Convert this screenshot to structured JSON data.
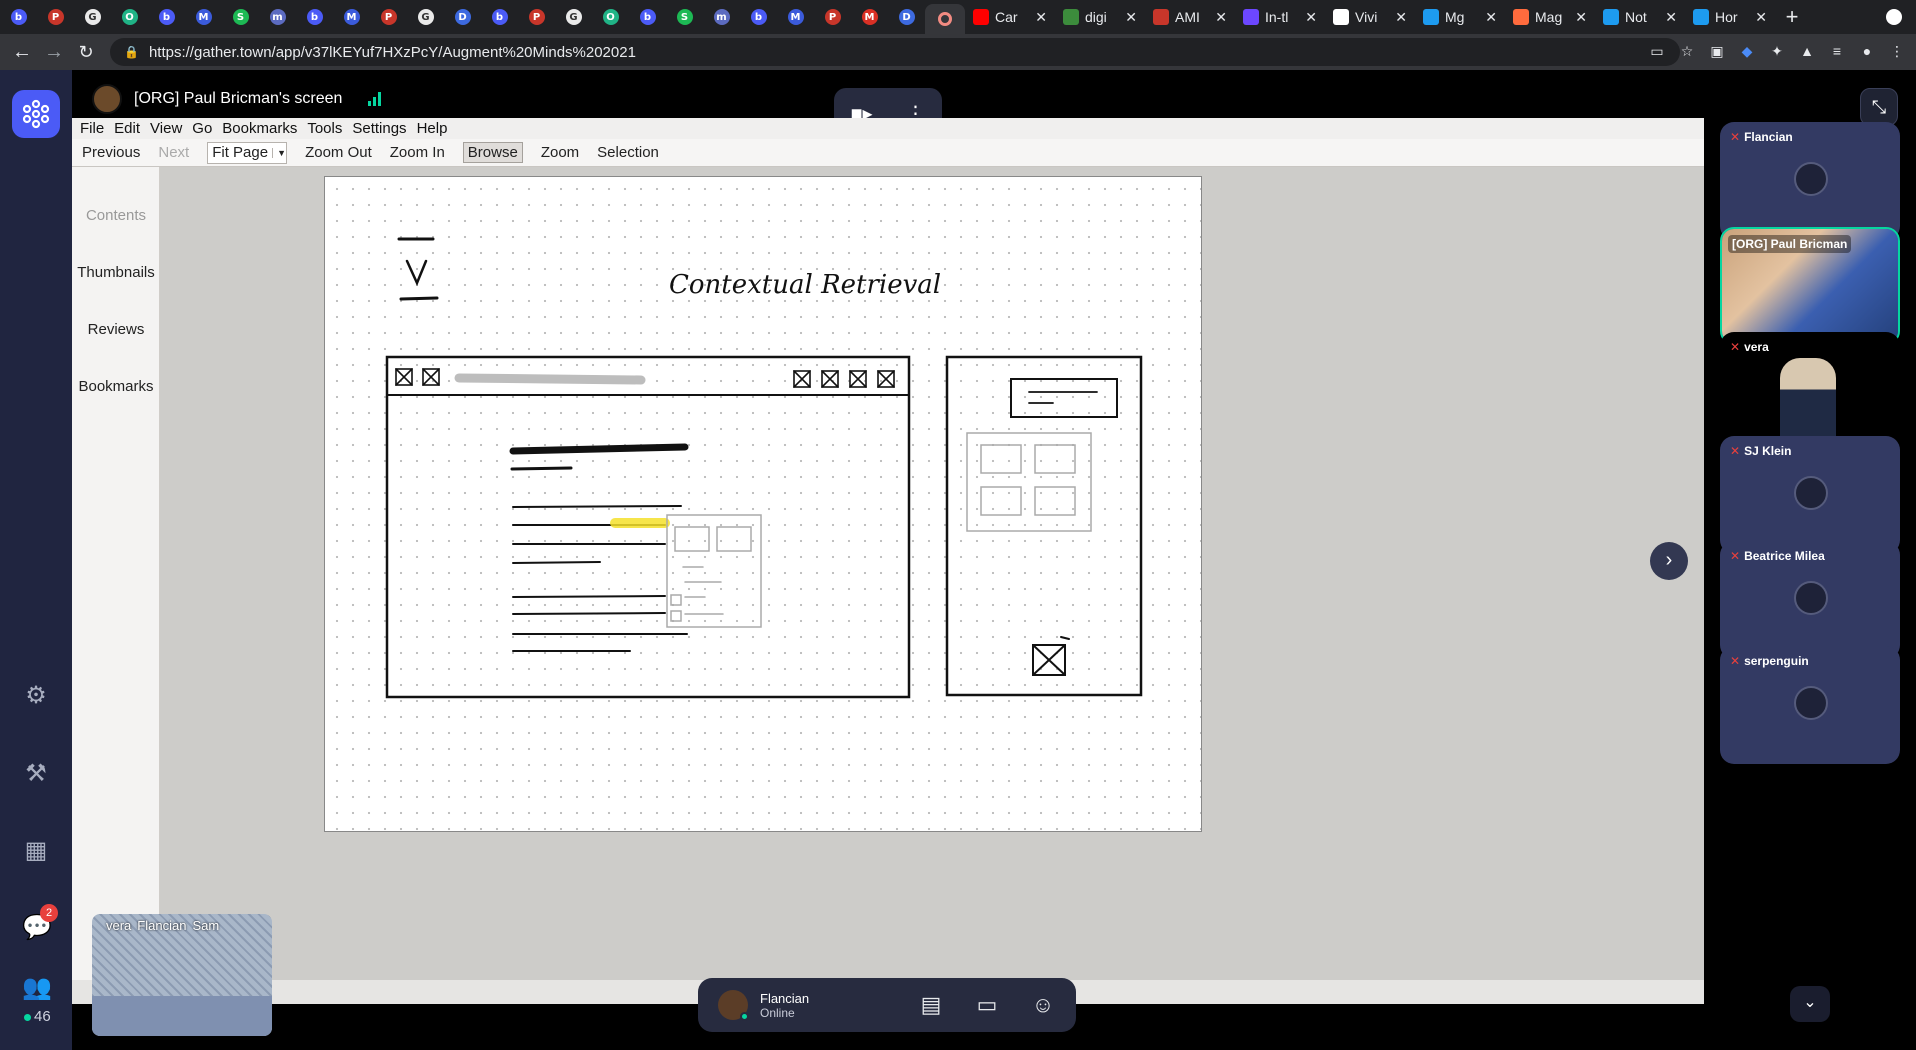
{
  "browser": {
    "tabs_mini": [
      {
        "color": "#4b5bf6",
        "glyph": "b"
      },
      {
        "color": "#c8362a",
        "glyph": "P"
      },
      {
        "color": "#eaeaea",
        "glyph": "G"
      },
      {
        "color": "#20b386",
        "glyph": "O"
      },
      {
        "color": "#4b5bf6",
        "glyph": "b"
      },
      {
        "color": "#3b5bdb",
        "glyph": "M"
      },
      {
        "color": "#1db954",
        "glyph": "S"
      },
      {
        "color": "#5c6bc0",
        "glyph": "m"
      },
      {
        "color": "#4b5bf6",
        "glyph": "b"
      },
      {
        "color": "#3b5bdb",
        "glyph": "M"
      },
      {
        "color": "#c8362a",
        "glyph": "P"
      },
      {
        "color": "#eaeaea",
        "glyph": "G"
      },
      {
        "color": "#3d6ae0",
        "glyph": "D"
      },
      {
        "color": "#4b5bf6",
        "glyph": "b"
      },
      {
        "color": "#c8362a",
        "glyph": "P"
      },
      {
        "color": "#eaeaea",
        "glyph": "G"
      },
      {
        "color": "#20b386",
        "glyph": "O"
      },
      {
        "color": "#4b5bf6",
        "glyph": "b"
      },
      {
        "color": "#1db954",
        "glyph": "S"
      },
      {
        "color": "#5c6bc0",
        "glyph": "m"
      },
      {
        "color": "#4b5bf6",
        "glyph": "b"
      },
      {
        "color": "#3b5bdb",
        "glyph": "M"
      },
      {
        "color": "#c8362a",
        "glyph": "P"
      },
      {
        "color": "#d93025",
        "glyph": "M"
      },
      {
        "color": "#3d6ae0",
        "glyph": "D"
      }
    ],
    "tabs_wide": [
      {
        "title": "Car",
        "icon": "youtube-icon",
        "color": "#ff0000"
      },
      {
        "title": "digi",
        "icon": "document-icon",
        "color": "#3c8c3c"
      },
      {
        "title": "AMI",
        "icon": "hp-icon",
        "color": "#c8362a"
      },
      {
        "title": "In-tl",
        "icon": "feather-icon",
        "color": "#6c47ff"
      },
      {
        "title": "Vivi",
        "icon": "circle-icon",
        "color": "#ffffff"
      },
      {
        "title": "Mg",
        "icon": "twitter-icon",
        "color": "#1d9bf0"
      },
      {
        "title": "Mag",
        "icon": "medium-icon",
        "color": "#ff6b3d"
      },
      {
        "title": "Not",
        "icon": "twitter-icon",
        "color": "#1d9bf0"
      },
      {
        "title": "Hor",
        "icon": "twitter-icon",
        "color": "#1d9bf0"
      }
    ],
    "url": "https://gather.town/app/v37lKEYuf7HXzPcY/Augment%20Minds%202021"
  },
  "share": {
    "title": "[ORG] Paul Bricman's screen"
  },
  "viewer": {
    "menu": [
      "File",
      "Edit",
      "View",
      "Go",
      "Bookmarks",
      "Tools",
      "Settings",
      "Help"
    ],
    "toolbar": {
      "previous": "Previous",
      "next": "Next",
      "zoom_value": "Fit Page",
      "zoom_out": "Zoom Out",
      "zoom_in": "Zoom In",
      "browse": "Browse",
      "zoom": "Zoom",
      "selection": "Selection"
    },
    "sidepane": [
      "Contents",
      "Thumbnails",
      "Reviews",
      "Bookmarks"
    ],
    "sketch_title": "Contextual Retrieval"
  },
  "participants": [
    {
      "name": "Flancian",
      "video": false
    },
    {
      "name": "[ORG] Paul Bricman",
      "video": true
    },
    {
      "name": "vera",
      "video": false
    },
    {
      "name": "SJ Klein",
      "video": false
    },
    {
      "name": "Beatrice Milea",
      "video": false
    },
    {
      "name": "serpenguin",
      "video": false
    }
  ],
  "minimap": {
    "names": [
      "vera",
      "Flancian",
      "Sam"
    ]
  },
  "nav": {
    "chat_badge": "2",
    "people_count": "46"
  },
  "user": {
    "name": "Flancian",
    "status": "Online"
  },
  "colors": {
    "accent": "#4b5bf6",
    "online": "#06d6a0",
    "muted": "#e8403d",
    "highlight": "#f5e12b"
  }
}
